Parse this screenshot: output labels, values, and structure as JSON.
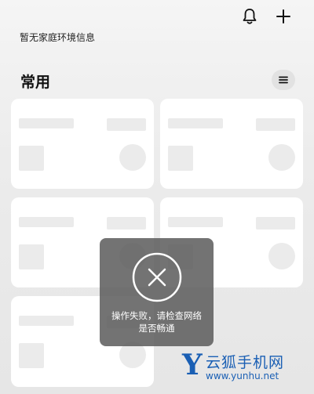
{
  "header": {
    "home_info": "暂无家庭环境信息",
    "bell_icon": "bell-icon",
    "add_icon": "plus-icon"
  },
  "section": {
    "title": "常用",
    "menu_icon": "list-icon"
  },
  "toast": {
    "icon": "close-circle-icon",
    "message": "操作失败，请检查网络是否畅通"
  },
  "watermark": {
    "letter": "Y",
    "name": "云狐手机网",
    "url": "www.yunhu.net"
  },
  "colors": {
    "watermark": "#1a5fb4",
    "card_background": "#ffffff",
    "placeholder": "#ebebeb"
  }
}
